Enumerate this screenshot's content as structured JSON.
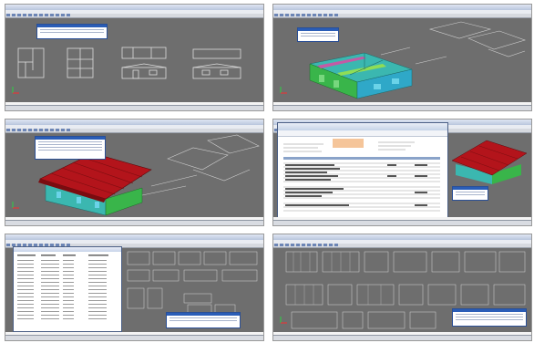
{
  "panels": [
    {
      "id": "floor-plan-elevations"
    },
    {
      "id": "3d-wall-frames"
    },
    {
      "id": "3d-roof-model"
    },
    {
      "id": "quote-spreadsheet"
    },
    {
      "id": "materials-list"
    },
    {
      "id": "wall-panel-drawings"
    }
  ],
  "icons": {
    "ucs": "ucs-axis-icon"
  }
}
